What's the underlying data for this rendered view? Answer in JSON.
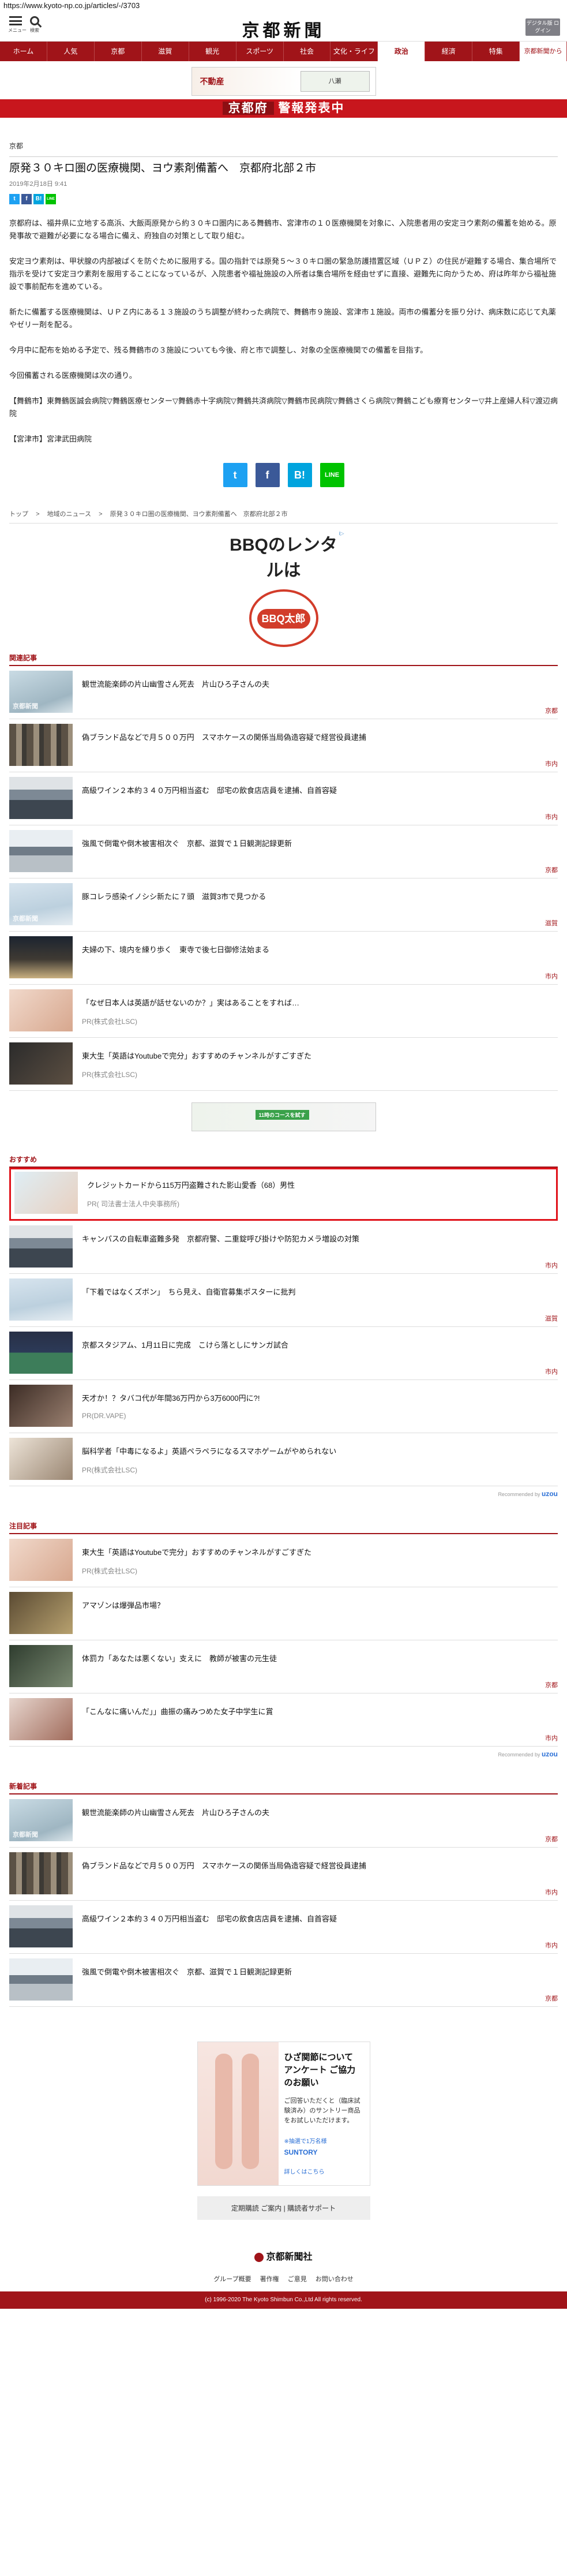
{
  "url": "https://www.kyoto-np.co.jp/articles/-/3703",
  "header": {
    "menu_label": "メニュー",
    "search_label": "検索",
    "logo": "京都新聞",
    "digital_badge": "デジタル版 ログイン"
  },
  "nav": [
    "ホーム",
    "人気",
    "京都",
    "滋賀",
    "観光",
    "スポーツ",
    "社会",
    "文化・ライフ",
    "政治",
    "経済",
    "特集",
    "京都新聞から"
  ],
  "top_ad": {
    "brand": "不動産",
    "map_label": "八瀬"
  },
  "banner": {
    "lead": "京都府",
    "text": "警報発表中"
  },
  "article": {
    "category": "京都",
    "title": "原発３０キロ圏の医療機関、ヨウ素剤備蓄へ　京都府北部２市",
    "date": "2019年2月18日 9:41",
    "paragraphs": [
      "京都府は、福井県に立地する高浜、大飯両原発から約３０キロ圏内にある舞鶴市、宮津市の１０医療機関を対象に、入院患者用の安定ヨウ素剤の備蓄を始める。原発事故で避難が必要になる場合に備え、府独自の対策として取り組む。",
      "安定ヨウ素剤は、甲状腺の内部被ばくを防ぐために服用する。国の指針では原発５～３０キロ圏の緊急防護措置区域（ＵＰＺ）の住民が避難する場合、集合場所で指示を受けて安定ヨウ素剤を服用することになっているが、入院患者や福祉施設の入所者は集合場所を経由せずに直接、避難先に向かうため、府は昨年から福祉施設で事前配布を進めている。",
      "新たに備蓄する医療機関は、ＵＰＺ内にある１３施設のうち調整が終わった病院で、舞鶴市９施設、宮津市１施設。両市の備蓄分を振り分け、病床数に応じて丸薬やゼリー剤を配る。",
      "今月中に配布を始める予定で、残る舞鶴市の３施設についても今後、府と市で調整し、対象の全医療機関での備蓄を目指す。",
      "今回備蓄される医療機関は次の通り。",
      "【舞鶴市】東舞鶴医誠会病院▽舞鶴医療センター▽舞鶴赤十字病院▽舞鶴共済病院▽舞鶴市民病院▽舞鶴さくら病院▽舞鶴こども療育センター▽井上産婦人科▽渡辺病院",
      "【宮津市】宮津武田病院"
    ]
  },
  "share": {
    "twitter": "t",
    "facebook": "f",
    "hatena": "B!",
    "line": "LINE"
  },
  "breadcrumb": [
    "トップ",
    ">",
    "地域のニュース",
    ">",
    "原発３０キロ圏の医療機関、ヨウ素剤備蓄へ　京都府北部２市"
  ],
  "mid_ad": {
    "headline": "BBQのレンタルは",
    "logo": "BBQ太郎",
    "mark": "i▷"
  },
  "related": {
    "heading": "関連記事",
    "items": [
      {
        "title": "観世流能楽師の片山幽雪さん死去　片山ひろ子さんの夫",
        "sub": "",
        "cat": "京都"
      },
      {
        "title": "偽ブランド品などで月５００万円　スマホケースの関係当局偽造容疑で経営役員逮捕",
        "sub": "",
        "cat": "市内"
      },
      {
        "title": "高級ワイン２本約３４０万円相当盗む　邸宅の飲食店店員を逮捕、自首容疑",
        "sub": "",
        "cat": "市内"
      },
      {
        "title": "強風で倒電や倒木被害相次ぐ　京都、滋賀で１日観測記録更新",
        "sub": "",
        "cat": "京都"
      },
      {
        "title": "豚コレラ感染イノシシ新たに７頭　滋賀3市で見つかる",
        "sub": "",
        "cat": "滋賀"
      },
      {
        "title": "夫婦の下、境内を練り歩く　東寺で後七日御修法始まる",
        "sub": "",
        "cat": "市内"
      },
      {
        "title": "「なぜ日本人は英語が話せないのか？」実はあることをすれば…",
        "sub": "PR(株式会社LSC)",
        "cat": ""
      },
      {
        "title": "東大生「英語はYoutubeで完分」おすすめのチャンネルがすごすぎた",
        "sub": "PR(株式会社LSC)",
        "cat": ""
      }
    ]
  },
  "small_ad": {
    "label": "11時のコースを試す"
  },
  "recommend": {
    "heading": "おすすめ",
    "items": [
      {
        "title": "クレジットカードから115万円盗難された影山愛香（68）男性",
        "sub": "PR( 司法書士法人中央事務所)",
        "cat": ""
      },
      {
        "title": "キャンパスの自転車盗難多発　京都府警、二重錠呼び掛けや防犯カメラ増設の対策",
        "sub": "",
        "cat": "市内"
      },
      {
        "title": "「下着ではなくズボン」　ちら見え、自衛官募集ポスターに批判",
        "sub": "",
        "cat": "滋賀"
      },
      {
        "title": "京都スタジアム、1月11日に完成　こけら落としにサンガ試合",
        "sub": "",
        "cat": "市内"
      },
      {
        "title": "天才か！？タバコ代が年間36万円から3万6000円に?!",
        "sub": "PR(DR.VAPE)",
        "cat": ""
      },
      {
        "title": "脳科学者「中毒になるよ」英語ペラペラになるスマホゲームがやめられない",
        "sub": "PR(株式会社LSC)",
        "cat": ""
      }
    ],
    "powered": "Recommended by",
    "powered_brand": "uzou"
  },
  "attention": {
    "heading": "注目記事",
    "items": [
      {
        "title": "東大生「英語はYoutubeで完分」おすすめのチャンネルがすごすぎた",
        "sub": "PR(株式会社LSC)",
        "cat": ""
      },
      {
        "title": "アマゾンは爆弾品市場？",
        "sub": "",
        "cat": ""
      },
      {
        "title": "体罰カ「あなたは悪くない」支えに　教師が被害の元生徒",
        "sub": "",
        "cat": "京都"
      },
      {
        "title": "「こんなに痛いんだ」」曲振の痛みつめた女子中学生に賞",
        "sub": "",
        "cat": "市内"
      }
    ],
    "powered": "Recommended by",
    "powered_brand": "uzou"
  },
  "latest": {
    "heading": "新着記事",
    "items": [
      {
        "title": "観世流能楽師の片山幽雪さん死去　片山ひろ子さんの夫",
        "sub": "",
        "cat": "京都"
      },
      {
        "title": "偽ブランド品などで月５００万円　スマホケースの関係当局偽造容疑で経営役員逮捕",
        "sub": "",
        "cat": "市内"
      },
      {
        "title": "高級ワイン２本約３４０万円相当盗む　邸宅の飲食店店員を逮捕、自首容疑",
        "sub": "",
        "cat": "市内"
      },
      {
        "title": "強風で倒電や倒木被害相次ぐ　京都、滋賀で１日観測記録更新",
        "sub": "",
        "cat": "京都"
      }
    ]
  },
  "bottom_ad": {
    "t1": "ひざ関節について アンケート ご協力のお願い",
    "t2": "ご回答いただくと（臨床試験済み）のサントリー商品をお試しいただけます。",
    "t3": "※抽選で1万名様",
    "t4": "SUNTORY",
    "more": "詳しくはこちら"
  },
  "links": [
    "定期購読 ご案内",
    "|",
    "購読者サポート"
  ],
  "footer": {
    "logo": "京都新聞社",
    "links": [
      "グループ概要",
      "著作権",
      "ご意見",
      "お問い合わせ"
    ],
    "copyright": "(c) 1996-2020 The Kyoto Shimbun Co.,Ltd All rights reserved."
  },
  "colors": {
    "brand": "#a01419",
    "alert": "#c8161d",
    "highlight": "#e0121a"
  }
}
